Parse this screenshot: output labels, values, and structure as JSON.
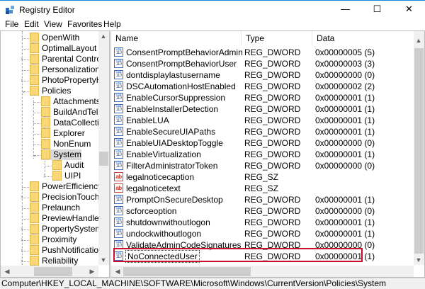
{
  "window": {
    "title": "Registry Editor",
    "minimize": "—",
    "maximize": "☐",
    "close": "✕"
  },
  "menu": [
    "File",
    "Edit",
    "View",
    "Favorites",
    "Help"
  ],
  "tree": [
    {
      "label": "OpenWith",
      "level": 1,
      "expander": ""
    },
    {
      "label": "OptimalLayout",
      "level": 1,
      "expander": ""
    },
    {
      "label": "Parental Controls",
      "level": 1,
      "expander": ">"
    },
    {
      "label": "Personalization",
      "level": 1,
      "expander": ""
    },
    {
      "label": "PhotoPropertyHar",
      "level": 1,
      "expander": ">"
    },
    {
      "label": "Policies",
      "level": 1,
      "expander": "v"
    },
    {
      "label": "Attachments",
      "level": 2,
      "expander": ""
    },
    {
      "label": "BuildAndTel",
      "level": 2,
      "expander": ""
    },
    {
      "label": "DataCollection",
      "level": 2,
      "expander": ""
    },
    {
      "label": "Explorer",
      "level": 2,
      "expander": ""
    },
    {
      "label": "NonEnum",
      "level": 2,
      "expander": ""
    },
    {
      "label": "System",
      "level": 2,
      "expander": "v",
      "selected": true
    },
    {
      "label": "Audit",
      "level": 3,
      "expander": ""
    },
    {
      "label": "UIPI",
      "level": 3,
      "expander": ">"
    },
    {
      "label": "PowerEfficiencyDi",
      "level": 1,
      "expander": ""
    },
    {
      "label": "PrecisionTouchPa",
      "level": 1,
      "expander": ">"
    },
    {
      "label": "Prelaunch",
      "level": 1,
      "expander": ""
    },
    {
      "label": "PreviewHandlers",
      "level": 1,
      "expander": ""
    },
    {
      "label": "PropertySystem",
      "level": 1,
      "expander": ">"
    },
    {
      "label": "Proximity",
      "level": 1,
      "expander": ">"
    },
    {
      "label": "PushNotifications",
      "level": 1,
      "expander": ">"
    },
    {
      "label": "Reliability",
      "level": 1,
      "expander": ">"
    }
  ],
  "list": {
    "headers": {
      "name": "Name",
      "type": "Type",
      "data": "Data"
    },
    "rows": [
      {
        "name": "ConsentPromptBehaviorAdmin",
        "type": "REG_DWORD",
        "data": "0x00000005 (5)",
        "icon": "dword"
      },
      {
        "name": "ConsentPromptBehaviorUser",
        "type": "REG_DWORD",
        "data": "0x00000003 (3)",
        "icon": "dword"
      },
      {
        "name": "dontdisplaylastusername",
        "type": "REG_DWORD",
        "data": "0x00000000 (0)",
        "icon": "dword"
      },
      {
        "name": "DSCAutomationHostEnabled",
        "type": "REG_DWORD",
        "data": "0x00000002 (2)",
        "icon": "dword"
      },
      {
        "name": "EnableCursorSuppression",
        "type": "REG_DWORD",
        "data": "0x00000001 (1)",
        "icon": "dword"
      },
      {
        "name": "EnableInstallerDetection",
        "type": "REG_DWORD",
        "data": "0x00000001 (1)",
        "icon": "dword"
      },
      {
        "name": "EnableLUA",
        "type": "REG_DWORD",
        "data": "0x00000001 (1)",
        "icon": "dword"
      },
      {
        "name": "EnableSecureUIAPaths",
        "type": "REG_DWORD",
        "data": "0x00000001 (1)",
        "icon": "dword"
      },
      {
        "name": "EnableUIADesktopToggle",
        "type": "REG_DWORD",
        "data": "0x00000000 (0)",
        "icon": "dword"
      },
      {
        "name": "EnableVirtualization",
        "type": "REG_DWORD",
        "data": "0x00000001 (1)",
        "icon": "dword"
      },
      {
        "name": "FilterAdministratorToken",
        "type": "REG_DWORD",
        "data": "0x00000000 (0)",
        "icon": "dword"
      },
      {
        "name": "legalnoticecaption",
        "type": "REG_SZ",
        "data": "",
        "icon": "sz"
      },
      {
        "name": "legalnoticetext",
        "type": "REG_SZ",
        "data": "",
        "icon": "sz"
      },
      {
        "name": "PromptOnSecureDesktop",
        "type": "REG_DWORD",
        "data": "0x00000001 (1)",
        "icon": "dword"
      },
      {
        "name": "scforceoption",
        "type": "REG_DWORD",
        "data": "0x00000000 (0)",
        "icon": "dword"
      },
      {
        "name": "shutdownwithoutlogon",
        "type": "REG_DWORD",
        "data": "0x00000001 (1)",
        "icon": "dword"
      },
      {
        "name": "undockwithoutlogon",
        "type": "REG_DWORD",
        "data": "0x00000001 (1)",
        "icon": "dword"
      },
      {
        "name": "ValidateAdminCodeSignatures",
        "type": "REG_DWORD",
        "data": "0x00000000 (0)",
        "icon": "dword"
      },
      {
        "name": "NoConnectedUser",
        "type": "REG_DWORD",
        "data": "0x00000001 (1)",
        "icon": "dword",
        "focused": true,
        "highlighted": true
      }
    ]
  },
  "status": "Computer\\HKEY_LOCAL_MACHINE\\SOFTWARE\\Microsoft\\Windows\\CurrentVersion\\Policies\\System",
  "colors": {
    "highlight": "#c8102e",
    "folder": "#f8d775",
    "selected": "#d9d9d9"
  }
}
